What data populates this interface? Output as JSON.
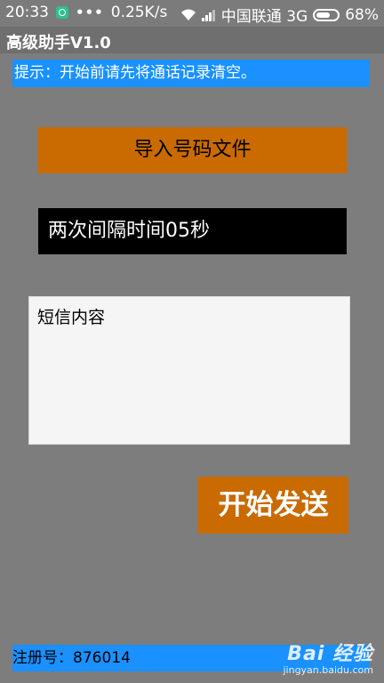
{
  "status_bar": {
    "time": "20:33",
    "dots": "•••",
    "speed": "0.25K/s",
    "carrier": "中国联通 3G",
    "battery": "68%",
    "battery_level": 0.68,
    "icons": [
      "app-notification-icon",
      "wifi-icon",
      "signal-icon",
      "battery-icon"
    ]
  },
  "app": {
    "title": "高级助手V1.0"
  },
  "hint": {
    "text": "提示：开始前请先将通话记录清空。"
  },
  "import_button": {
    "label": "导入号码文件"
  },
  "interval": {
    "text": "两次间隔时间05秒"
  },
  "sms": {
    "placeholder": "短信内容"
  },
  "send_button": {
    "label": "开始发送"
  },
  "registration": {
    "text": "注册号：876014"
  },
  "watermark": {
    "brand": "Bai 经验",
    "url": "jingyan.baidu.com"
  },
  "colors": {
    "background": "#7d7d7d",
    "accent_orange": "#c96b00",
    "banner_blue": "#1a91ff",
    "interval_bg": "#000000"
  }
}
